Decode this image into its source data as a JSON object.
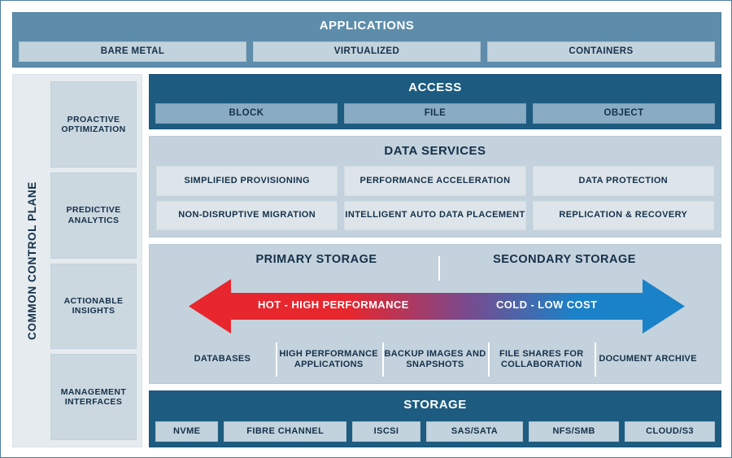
{
  "applications": {
    "title": "APPLICATIONS",
    "tiles": [
      {
        "label": "BARE METAL"
      },
      {
        "label": "VIRTUALIZED"
      },
      {
        "label": "CONTAINERS"
      }
    ]
  },
  "control_plane": {
    "title": "COMMON CONTROL PLANE",
    "tiles": [
      {
        "label": "PROACTIVE OPTIMIZATION"
      },
      {
        "label": "PREDICTIVE ANALYTICS"
      },
      {
        "label": "ACTIONABLE INSIGHTS"
      },
      {
        "label": "MANAGEMENT INTERFACES"
      }
    ]
  },
  "access": {
    "title": "ACCESS",
    "tiles": [
      {
        "label": "BLOCK"
      },
      {
        "label": "FILE"
      },
      {
        "label": "OBJECT"
      }
    ]
  },
  "data_services": {
    "title": "DATA SERVICES",
    "row1": [
      {
        "label": "SIMPLIFIED PROVISIONING"
      },
      {
        "label": "PERFORMANCE ACCELERATION"
      },
      {
        "label": "DATA PROTECTION"
      }
    ],
    "row2": [
      {
        "label": "NON-DISRUPTIVE MIGRATION"
      },
      {
        "label": "INTELLIGENT AUTO DATA PLACEMENT"
      },
      {
        "label": "REPLICATION & RECOVERY"
      }
    ]
  },
  "tiering": {
    "primary_heading": "PRIMARY STORAGE",
    "secondary_heading": "SECONDARY STORAGE",
    "arrow_left_label": "HOT - HIGH PERFORMANCE",
    "arrow_right_label": "COLD - LOW COST",
    "arrow_colors": {
      "hot": "#e8262d",
      "mid": "#7a4a8e",
      "cold": "#1a82c8"
    },
    "use_cases": [
      {
        "label": "DATABASES"
      },
      {
        "label": "HIGH PERFORMANCE APPLICATIONS"
      },
      {
        "label": "BACKUP IMAGES AND SNAPSHOTS"
      },
      {
        "label": "FILE SHARES FOR COLLABORATION"
      },
      {
        "label": "DOCUMENT ARCHIVE"
      }
    ]
  },
  "storage": {
    "title": "STORAGE",
    "tiles": [
      {
        "label": "NVME",
        "flex": 0.72
      },
      {
        "label": "FIBRE CHANNEL",
        "flex": 1.42
      },
      {
        "label": "ISCSI",
        "flex": 0.78
      },
      {
        "label": "SAS/SATA",
        "flex": 1.12
      },
      {
        "label": "NFS/SMB",
        "flex": 1.04
      },
      {
        "label": "CLOUD/S3",
        "flex": 1.04
      }
    ]
  },
  "theme": {
    "band_applications_bg": "#5e8dab",
    "band_access_bg": "#1d5c80",
    "band_storage_bg": "#1d5c80",
    "panel_bg": "#c3d2dc",
    "sidebar_bg": "#e5ebef",
    "text_dark": "#15304a"
  }
}
